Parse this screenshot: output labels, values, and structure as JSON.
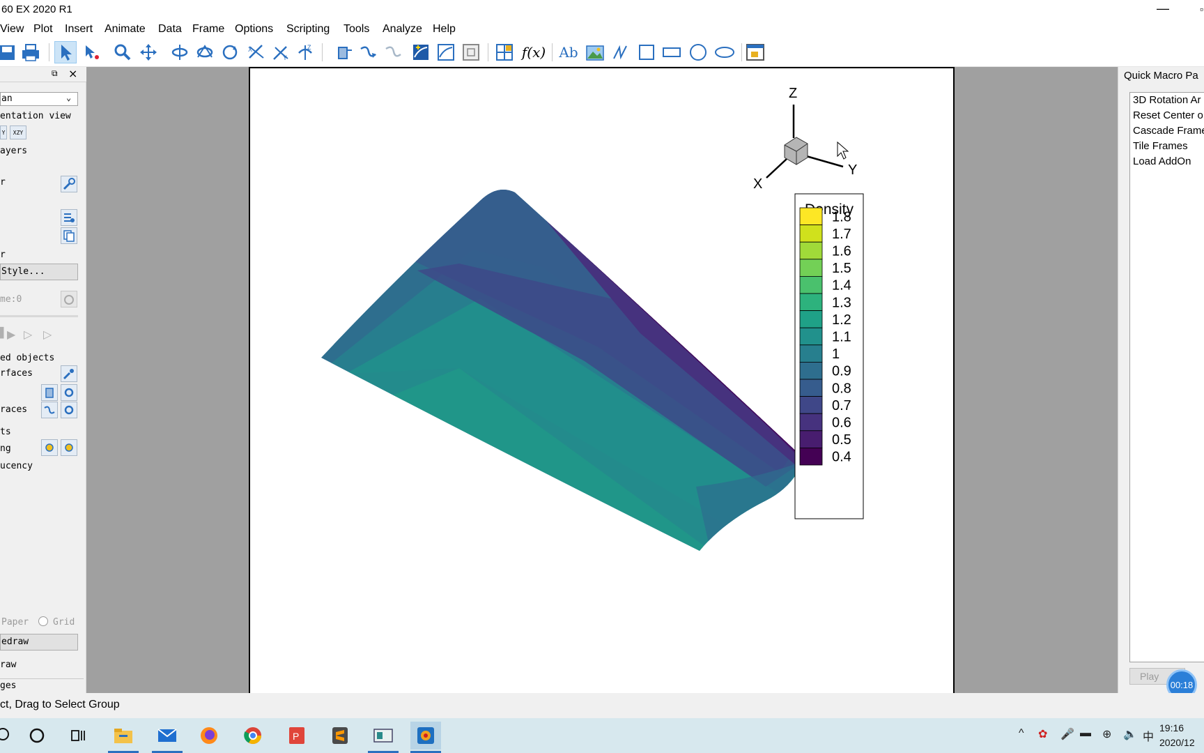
{
  "window": {
    "title": "60 EX 2020 R1",
    "minimize": "—",
    "maximize": "▫"
  },
  "menu": [
    "View",
    "Plot",
    "Insert",
    "Animate",
    "Data",
    "Frame",
    "Options",
    "Scripting",
    "Tools",
    "Analyze",
    "Help"
  ],
  "sidebar": {
    "dropdown": "an",
    "orientation": "entation view",
    "axis_buttons": [
      "Y",
      "XZY"
    ],
    "layers": "ayers",
    "item_r1": "r",
    "item_r2": "r",
    "style_button": "Style...",
    "time": "me:0",
    "objects": "ed objects",
    "surfaces": "rfaces",
    "traces": "races",
    "item_ts": "ts",
    "item_ng": "ng",
    "translucency": "ucency",
    "paper": "Paper",
    "grid": "Grid",
    "redraw": "edraw",
    "auto_redraw": "raw",
    "pages": "ges"
  },
  "plot": {
    "axes": {
      "x": "X",
      "y": "Y",
      "z": "Z"
    },
    "legend": {
      "title": "Density",
      "levels": [
        "1.8",
        "1.7",
        "1.6",
        "1.5",
        "1.4",
        "1.3",
        "1.2",
        "1.1",
        "1",
        "0.9",
        "0.8",
        "0.7",
        "0.6",
        "0.5",
        "0.4"
      ],
      "colors": [
        "#fde725",
        "#d0e11c",
        "#a0da39",
        "#73d056",
        "#4ac16d",
        "#2db27d",
        "#1fa187",
        "#21918c",
        "#277f8e",
        "#2e6e8e",
        "#365c8d",
        "#3f4788",
        "#46327e",
        "#481d6f",
        "#440154"
      ]
    }
  },
  "macro_panel": {
    "title": "Quick Macro Pa",
    "items": [
      "3D Rotation Ar",
      "Reset Center o",
      "Cascade Frame",
      "Tile Frames",
      "Load AddOn"
    ],
    "play": "Play"
  },
  "timer": "00:18",
  "status": "ct, Drag to Select Group",
  "taskbar": {
    "ime": "中",
    "time": "19:16",
    "date": "2020/12"
  }
}
